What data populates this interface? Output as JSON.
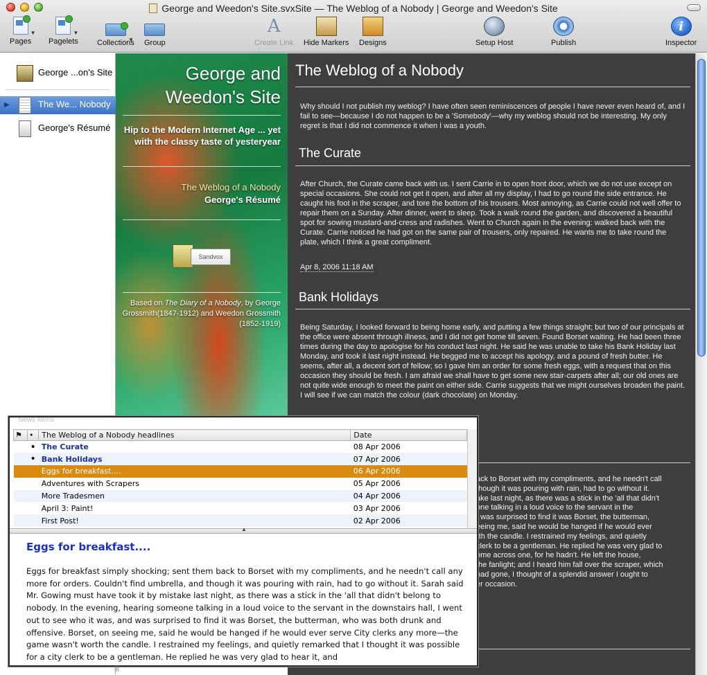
{
  "window": {
    "title": "George and Weedon's Site.svxSite — The Weblog of a Nobody | George and Weedon's Site"
  },
  "toolbar": {
    "pages": "Pages",
    "pagelets": "Pagelets",
    "collections": "Collections",
    "group": "Group",
    "create_link": "Create Link",
    "hide_markers": "Hide Markers",
    "designs": "Designs",
    "setup_host": "Setup Host",
    "publish": "Publish",
    "inspector": "Inspector"
  },
  "sidebar": {
    "items": [
      {
        "label": "George ...on's Site",
        "icon": "site-icon"
      },
      {
        "label": "The We... Nobody",
        "icon": "weblog-icon",
        "selected": true
      },
      {
        "label": "George's Résumé",
        "icon": "resume-icon"
      }
    ]
  },
  "site": {
    "title": "George and Weedon's Site",
    "tagline": "Hip to the Modern Internet Age ... yet with the classy taste of yesteryear",
    "nav": [
      "The Weblog of a Nobody",
      "George's Résumé"
    ],
    "badge": "Sandvox",
    "credit_prefix": "Based on ",
    "credit_book": "The Diary of a Nobody",
    "credit_rest": ", by George Grossmith(1847-1912) and Weedon Grossmith (1852-1919)"
  },
  "page": {
    "title": "The Weblog of a Nobody",
    "intro": "Why should I not publish my weblog? I have often seen reminiscences of people I have never even heard of, and I fail to see—because I do not happen to be a 'Somebody'—why my weblog should not be interesting. My only regret is that I did not commence it when I was a youth.",
    "posts": [
      {
        "title": "The Curate",
        "body": "After Church, the Curate came back with us. I sent Carrie in to open front door, which we do not use except on special occasions. She could not get it open, and after all my display, I had to go round the side entrance. He caught his foot in the scraper, and tore the bottom of his trousers. Most annoying, as Carrie could not well offer to repair them on a Sunday. After dinner, went to sleep. Took a walk round the garden, and discovered a beautiful spot for sowing mustard-and-cress and radishes. Went to Church again in the evening: walked back with the Curate. Carrie noticed he had got on the same pair of trousers, only repaired. He wants me to take round the plate, which I think a great compliment.",
        "date": "Apr 8, 2006 11:18 AM"
      },
      {
        "title": "Bank Holidays",
        "body": "Being Saturday, I looked forward to being home early, and putting a few things straight; but two of our principals at the office were absent through illness, and I did not get home till seven. Found Borset waiting. He had been three times during the day to apologise for his conduct last night. He said he was unable to take his Bank Holiday last Monday, and took it last night instead. He begged me to accept his apology, and a pound of fresh butter. He seems, after all, a decent sort of fellow; so I gave him an order for some fresh eggs, with a request that on this occasion they should be fresh. I am afraid we shall have to get some new stair-carpets after all; our old ones are not quite wide enough to meet the paint on either side. Carrie suggests that we might ourselves broaden the paint. I will see if we can match the colour (dark chocolate) on Monday."
      }
    ],
    "partial_lines": [
      "ack to Borset with my compliments, and he needn't call",
      " though it was pouring with rain, had to go without it.",
      "ake last night, as there was a stick in the 'all that didn't",
      "one talking in a loud voice to the servant in the",
      "I was surprised to find it was Borset, the butterman,",
      "eeing me, said he would be hanged if he would ever",
      "rth the candle. I restrained my feelings, and quietly",
      "clerk to be a gentleman. He replied he was very glad to",
      "ome across one, for he hadn't. He left the house,",
      "the fanlight; and I heard him fall over the scraper, which",
      "had gone, I thought of a splendid answer I ought to",
      "er occasion."
    ]
  },
  "news": {
    "faint_label": "News Items",
    "columns": {
      "flag": "⚑",
      "dot": "•",
      "headline": "The Weblog of a Nobody headlines",
      "date": "Date"
    },
    "rows": [
      {
        "bullet": "•",
        "headline": "The Curate",
        "date": "08 Apr 2006"
      },
      {
        "bullet": "•",
        "headline": "Bank Holidays",
        "date": "07 Apr 2006"
      },
      {
        "bullet": "",
        "headline": "Eggs for breakfast....",
        "date": "06 Apr 2006"
      },
      {
        "bullet": "",
        "headline": "Adventures with Scrapers",
        "date": "05 Apr 2006"
      },
      {
        "bullet": "",
        "headline": "More Tradesmen",
        "date": "04 Apr 2006"
      },
      {
        "bullet": "",
        "headline": "April 3: Paint!",
        "date": "03 Apr 2006"
      },
      {
        "bullet": "",
        "headline": "First Post!",
        "date": "02 Apr 2006"
      }
    ],
    "selected_title": "Eggs for breakfast....",
    "selected_text": "Eggs for breakfast simply shocking; sent them back to Borset with my compliments, and he needn't call any more for orders. Couldn't find umbrella, and though it was pouring with rain, had to go without it. Sarah said Mr. Gowing must have took it by mistake last night, as there was a stick in the 'all that didn't belong to nobody. In the evening, hearing someone talking in a loud voice to the servant in the downstairs hall, I went out to see who it was, and was surprised to find it was Borset, the butterman, who was both drunk and offensive. Borset, on seeing me, said he would be hanged if he would ever serve City clerks any more—the game wasn't worth the candle. I restrained my feelings, and quietly remarked that I thought it was possible for a city clerk to be a gentleman. He replied he was very glad to hear it, and"
  },
  "colors": {
    "content_bg": "#3e3e3e",
    "selection_orange": "#d98a11",
    "sidebar_selection": "#3a73c9",
    "link_blue": "#1a2fd0"
  }
}
